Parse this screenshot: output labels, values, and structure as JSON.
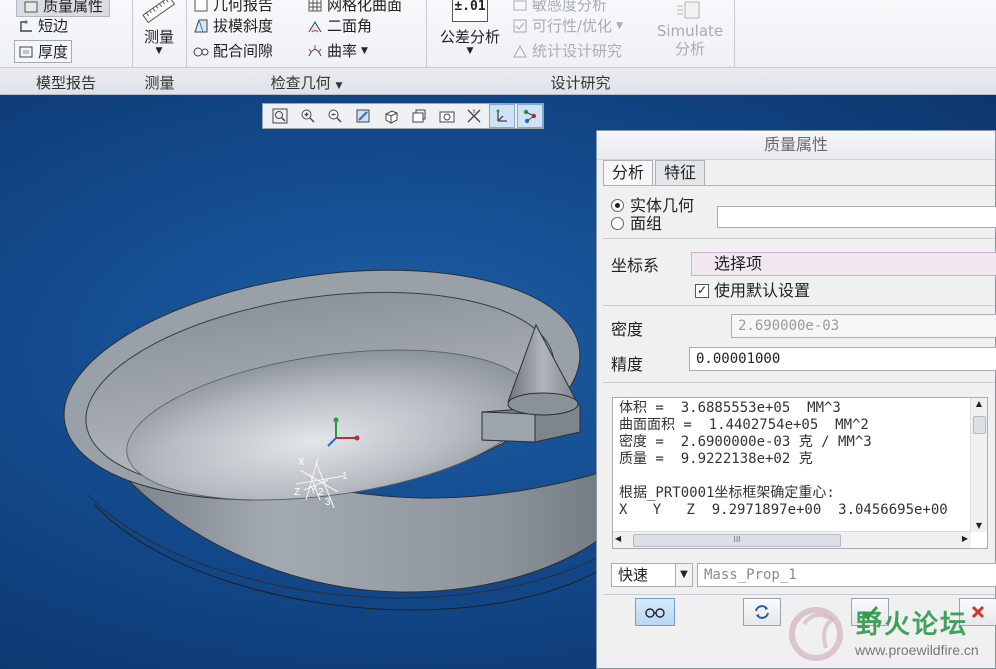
{
  "ribbon": {
    "model_report": {
      "items": [
        "质量属性",
        "短边",
        "厚度"
      ],
      "group_label": "模型报告"
    },
    "measure": {
      "button_label": "测量",
      "group_label": "测量"
    },
    "check_geometry": {
      "items_col1": [
        "几何报告",
        "拔模斜度",
        "配合间隙"
      ],
      "items_col2": [
        "网格化曲面",
        "二面角",
        "曲率"
      ],
      "group_label": "检查几何"
    },
    "design_study": {
      "tolerance_label": "公差分析",
      "tolerance_icon_text": "±.01",
      "items": [
        "敏感度分析",
        "可行性/优化",
        "统计设计研究"
      ],
      "simulate_line1": "Simulate",
      "simulate_line2": "分析",
      "group_label": "设计研究"
    }
  },
  "dialog": {
    "title": "质量属性",
    "tabs": [
      "分析",
      "特征"
    ],
    "radio_solid": "实体几何",
    "radio_quilt": "面组",
    "csys_label": "坐标系",
    "csys_value": "选择项",
    "use_default": "使用默认设置",
    "density_label": "密度",
    "density_value": "2.690000e-03",
    "accuracy_label": "精度",
    "accuracy_value": "0.00001000",
    "results_text": "体积 =  3.6885553e+05  MM^3\n曲面面积 =  1.4402754e+05  MM^2\n密度 =  2.6900000e-03 克 / MM^3\n质量 =  9.9222138e+02 克\n\n根据_PRT0001坐标框架确定重心:\nX   Y   Z  9.2971897e+00  3.0456695e+00",
    "mode_value": "快速",
    "name_value": "Mass_Prop_1",
    "scroll_grip": "III"
  },
  "watermark": {
    "text": "野火论坛",
    "url": "www.proewildfire.cn"
  },
  "csys_labels": {
    "x": "X",
    "y": "Y",
    "z": "Z",
    "n1": "1",
    "n2": "2",
    "n3": "3"
  },
  "colors": {
    "viewport_bg": "#134a8c",
    "model_gray": "#8c939b",
    "check_green": "#2fa33d",
    "close_red": "#d4342a",
    "watermark_green": "#2d9a4c"
  }
}
